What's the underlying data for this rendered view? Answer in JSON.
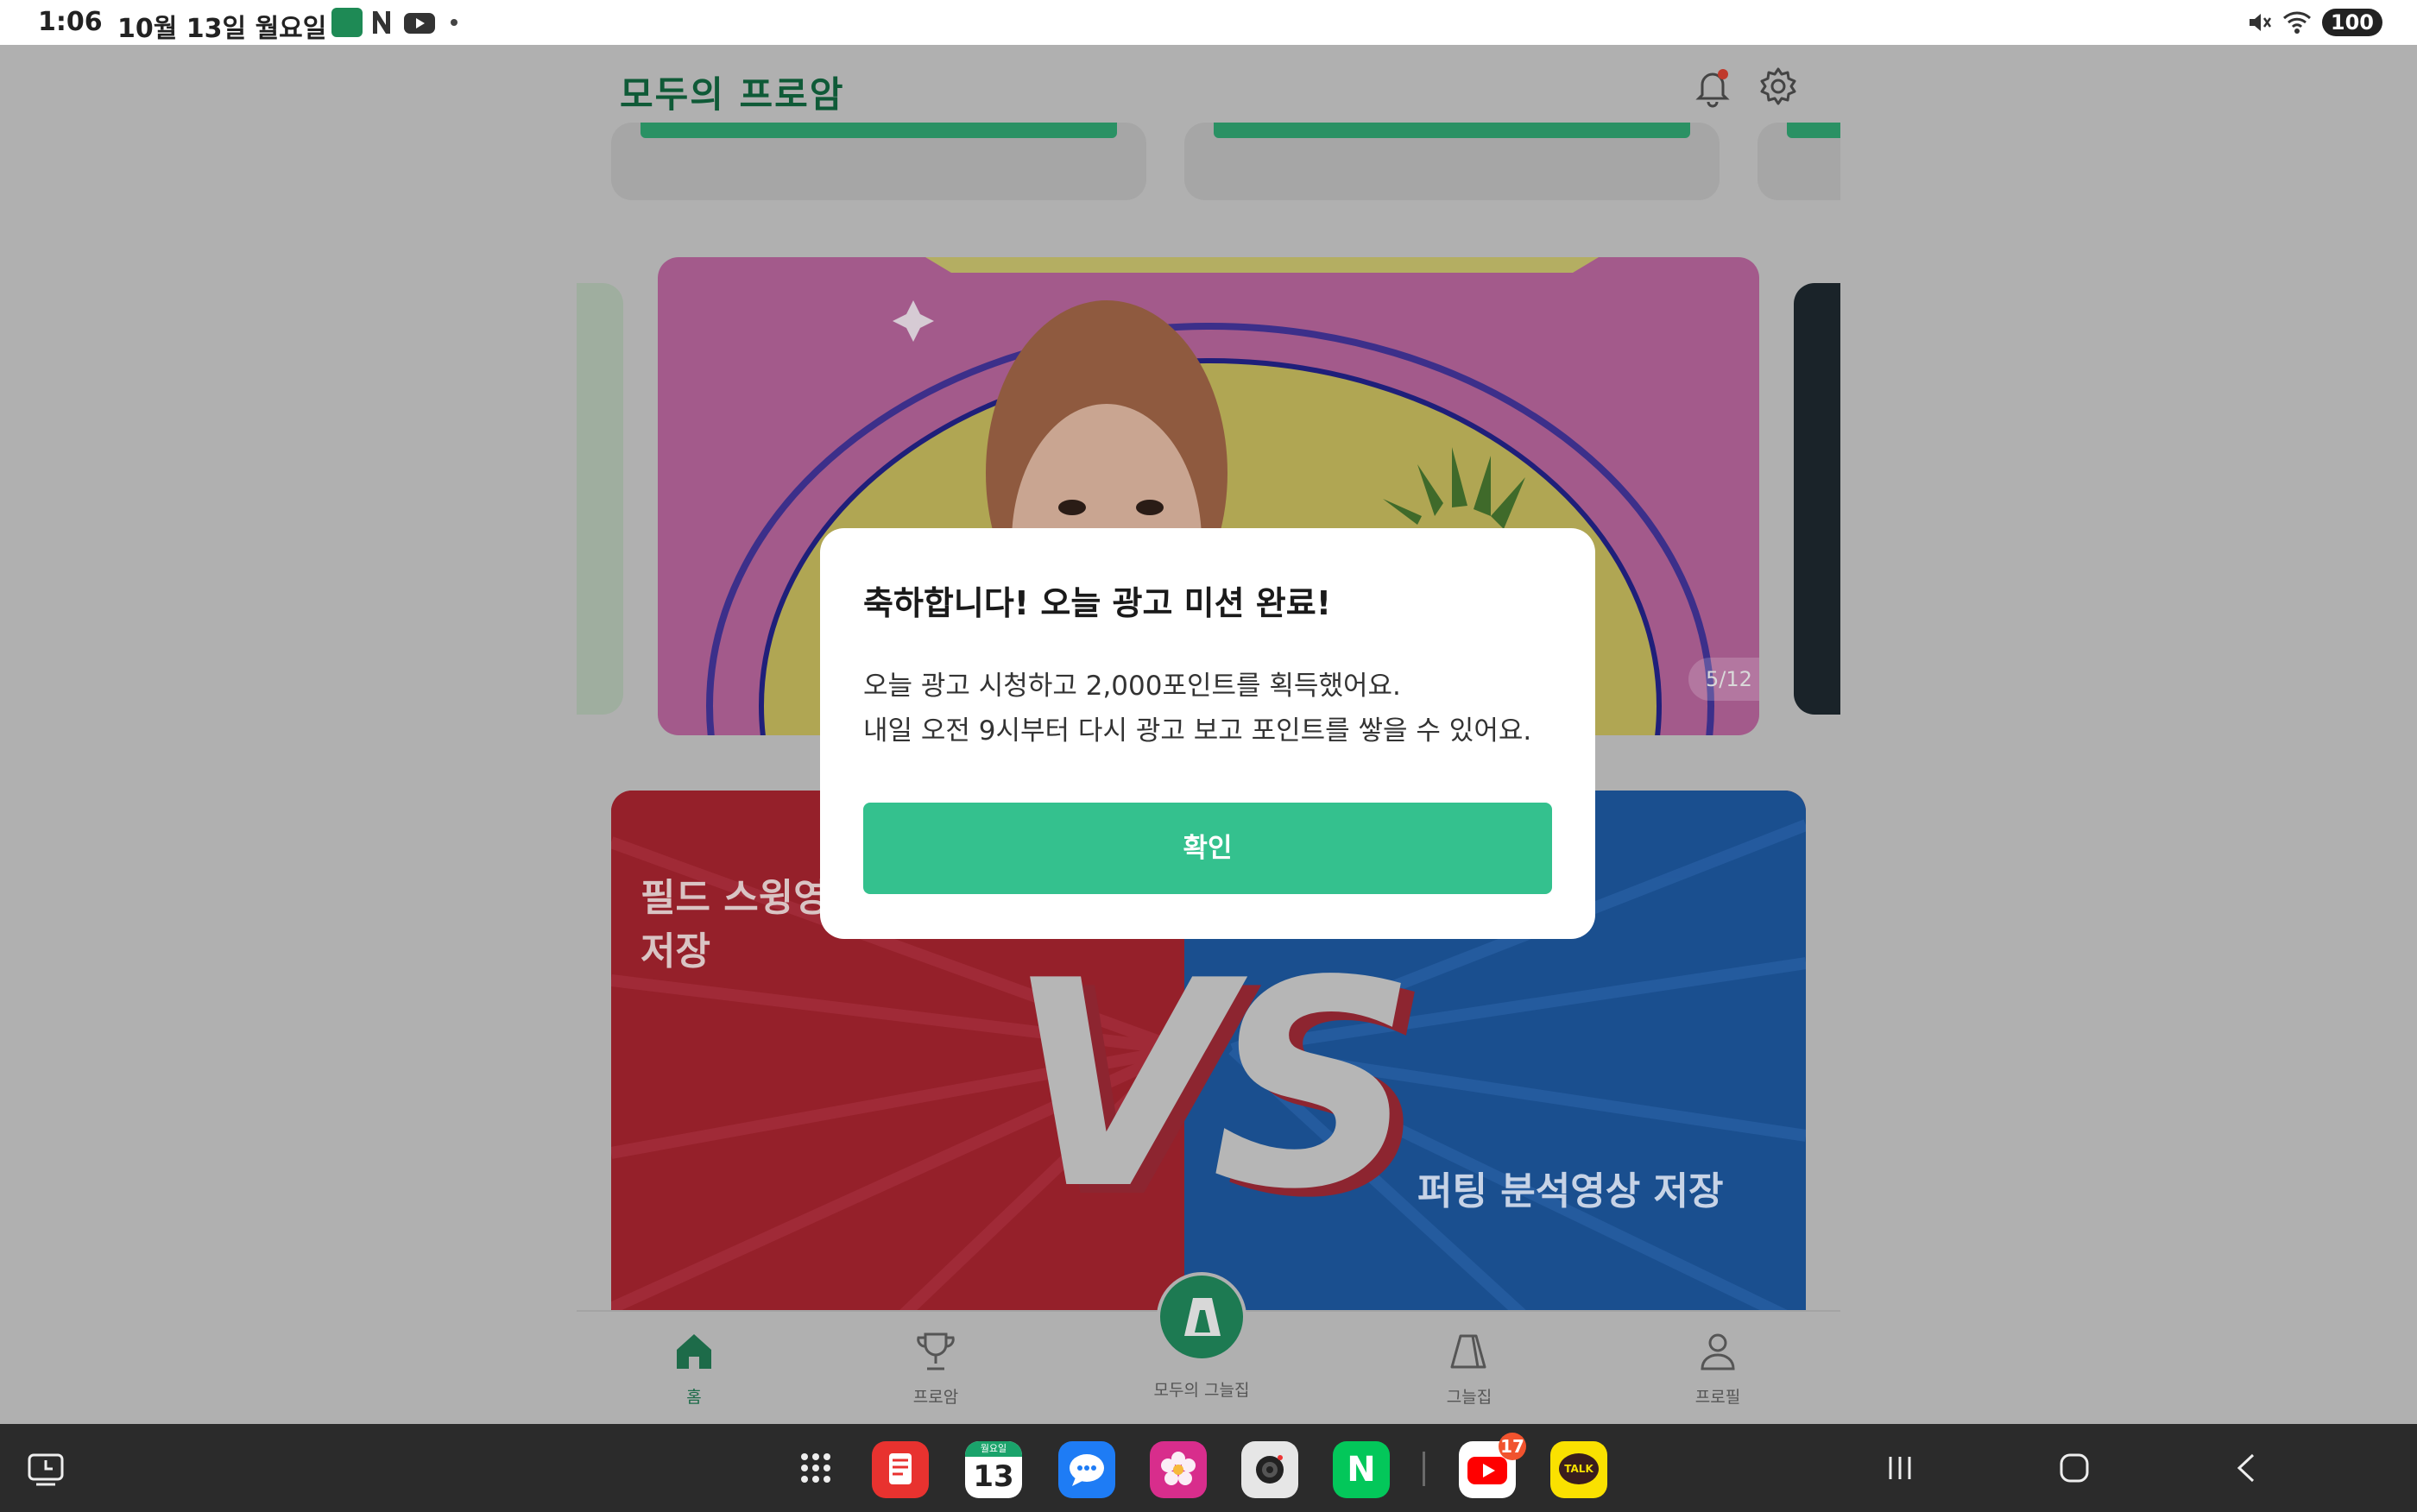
{
  "status_bar": {
    "time": "1:06",
    "date": "10월 13일 월요일",
    "battery": "100"
  },
  "app": {
    "logo": "모두의 프로암",
    "banner_page": "5/12",
    "vs_card": {
      "left_text": "필드 스윙영상 저장",
      "center_text": "VS",
      "right_text": "퍼팅 분석영상 저장"
    },
    "tabs": [
      {
        "label": "홈",
        "icon": "home-icon"
      },
      {
        "label": "프로암",
        "icon": "trophy-icon"
      },
      {
        "label": "모두의 그늘집",
        "icon": "shade-house-icon"
      },
      {
        "label": "그늘집",
        "icon": "tent-icon"
      },
      {
        "label": "프로필",
        "icon": "person-icon"
      }
    ]
  },
  "dialog": {
    "title": "축하합니다! 오늘 광고 미션 완료!",
    "body_line1": "오늘 광고 시청하고 2,000포인트를 획득했어요.",
    "body_line2": "내일 오전 9시부터 다시 광고 보고 포인트를 쌓을 수 있어요.",
    "confirm": "확인"
  },
  "dock": {
    "calendar_day": "월요일",
    "calendar_date": "13",
    "youtube_badge": "17",
    "kakao_label": "TALK",
    "naver_label": "N"
  },
  "colors": {
    "brand_green": "#34c18e",
    "logo_green": "#0f5a37",
    "overlay_gray": "#b0b0b0"
  }
}
